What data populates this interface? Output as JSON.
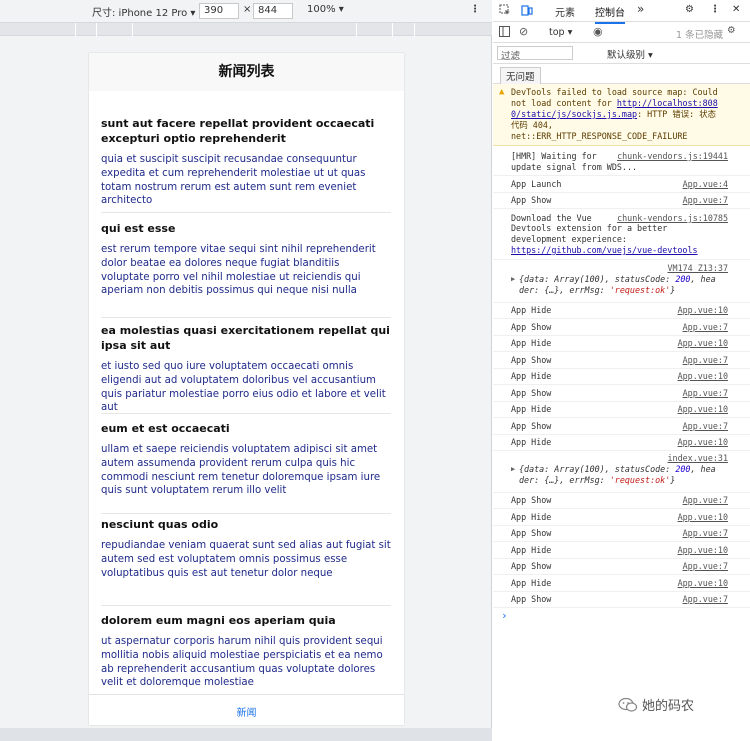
{
  "devbar": {
    "size_label": "尺寸: iPhone 12 Pro ▾",
    "width": "390",
    "times": "×",
    "height": "844",
    "zoom": "100% ▾"
  },
  "phone": {
    "nav_title": "新闻列表",
    "tab_label": "新闻",
    "items": [
      {
        "title": "sunt aut facere repellat provident occaecati excepturi optio reprehenderit",
        "body": "quia et suscipit suscipit recusandae consequuntur expedita et cum reprehenderit molestiae ut ut quas totam nostrum rerum est autem sunt rem eveniet architecto"
      },
      {
        "title": "qui est esse",
        "body": "est rerum tempore vitae sequi sint nihil reprehenderit dolor beatae ea dolores neque fugiat blanditiis voluptate porro vel nihil molestiae ut reiciendis qui aperiam non debitis possimus qui neque nisi nulla"
      },
      {
        "title": "ea molestias quasi exercitationem repellat qui ipsa sit aut",
        "body": "et iusto sed quo iure voluptatem occaecati omnis eligendi aut ad voluptatem doloribus vel accusantium quis pariatur molestiae porro eius odio et labore et velit aut"
      },
      {
        "title": "eum et est occaecati",
        "body": "ullam et saepe reiciendis voluptatem adipisci sit amet autem assumenda provident rerum culpa quis hic commodi nesciunt rem tenetur doloremque ipsam iure quis sunt voluptatem rerum illo velit"
      },
      {
        "title": "nesciunt quas odio",
        "body": "repudiandae veniam quaerat sunt sed alias aut fugiat sit autem sed est voluptatem omnis possimus esse voluptatibus quis est aut tenetur dolor neque"
      },
      {
        "title": "dolorem eum magni eos aperiam quia",
        "body": "ut aspernatur corporis harum nihil quis provident sequi mollitia nobis aliquid molestiae perspiciatis et ea nemo ab reprehenderit accusantium quas voluptate dolores velit et doloremque molestiae"
      }
    ]
  },
  "devtools": {
    "tabs": {
      "elements": "元素",
      "console": "控制台",
      "more": "»"
    },
    "toolbar": {
      "context": "top ▾",
      "issues": "1 条已隐藏",
      "filter_placeholder": "过滤",
      "level": "默认级别 ▾",
      "no_issues": "无问题"
    },
    "warning": {
      "line1": "DevTools failed to load source map: Could",
      "line2": "not load content for ",
      "link1": "http://localhost:808",
      "line3": "0/static/js/sockjs.js.map",
      "line3b": ": HTTP 错误: 状态",
      "line4": "代码 404,",
      "line5": "net::ERR_HTTP_RESPONSE_CODE_FAILURE"
    },
    "hmr": {
      "line1": "[HMR] Waiting for ",
      "src": "chunk-vendors.js:19441",
      "line2": "update signal from WDS..."
    },
    "logs": [
      {
        "msg": "App Launch",
        "src": "App.vue:4"
      },
      {
        "msg": "App Show",
        "src": "App.vue:7"
      }
    ],
    "download": {
      "l1": "Download the Vue",
      "src": "chunk-vendors.js:10785",
      "l2": "Devtools extension for a better",
      "l3": "development experience:",
      "l4": "https://github.com/vuejs/vue-devtools"
    },
    "obj1": {
      "src": "VM174 Z13:37",
      "l1a": "{data: Array(100), statusCode: ",
      "code": "200",
      "l1b": ", hea",
      "l2a": "der: {…}, errMsg: ",
      "msg": "'request:ok'",
      "l2b": "}"
    },
    "logs2": [
      {
        "msg": "App Hide",
        "src": "App.vue:10"
      },
      {
        "msg": "App Show",
        "src": "App.vue:7"
      },
      {
        "msg": "App Hide",
        "src": "App.vue:10"
      },
      {
        "msg": "App Show",
        "src": "App.vue:7"
      },
      {
        "msg": "App Hide",
        "src": "App.vue:10"
      },
      {
        "msg": "App Show",
        "src": "App.vue:7"
      },
      {
        "msg": "App Hide",
        "src": "App.vue:10"
      },
      {
        "msg": "App Show",
        "src": "App.vue:7"
      },
      {
        "msg": "App Hide",
        "src": "App.vue:10"
      }
    ],
    "obj2": {
      "src": "index.vue:31",
      "l1a": "{data: Array(100), statusCode: ",
      "code": "200",
      "l1b": ", hea",
      "l2a": "der: {…}, errMsg: ",
      "msg": "'request:ok'",
      "l2b": "}"
    },
    "logs3": [
      {
        "msg": "App Show",
        "src": "App.vue:7"
      },
      {
        "msg": "App Hide",
        "src": "App.vue:10"
      },
      {
        "msg": "App Show",
        "src": "App.vue:7"
      },
      {
        "msg": "App Hide",
        "src": "App.vue:10"
      },
      {
        "msg": "App Show",
        "src": "App.vue:7"
      },
      {
        "msg": "App Hide",
        "src": "App.vue:10"
      },
      {
        "msg": "App Show",
        "src": "App.vue:7"
      }
    ],
    "prompt": "›"
  },
  "watermark": "她的码农"
}
